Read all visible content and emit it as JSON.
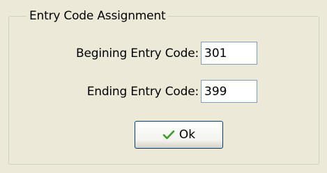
{
  "groupbox": {
    "title": "Entry Code Assignment"
  },
  "fields": {
    "begin": {
      "label": "Begining Entry Code:",
      "value": "301"
    },
    "end": {
      "label": "Ending Entry Code:",
      "value": "399"
    }
  },
  "ok_button": {
    "label": "Ok",
    "icon": "checkmark-icon",
    "icon_color": "#3a9a2a"
  }
}
